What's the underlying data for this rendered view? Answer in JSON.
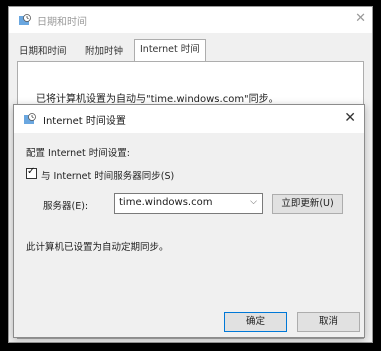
{
  "outer_window": {
    "title": "日期和时间",
    "tabs": [
      {
        "label": "日期和时间",
        "active": false
      },
      {
        "label": "附加时钟",
        "active": false
      },
      {
        "label": "Internet 时间",
        "active": true
      }
    ],
    "panel_text": "已将计算机设置为自动与\"time.windows.com\"同步。"
  },
  "dialog": {
    "title": "Internet 时间设置",
    "configure_label": "配置 Internet 时间设置:",
    "sync_checkbox": {
      "label": "与 Internet 时间服务器同步(S)",
      "checked": true
    },
    "server_label": "服务器(E):",
    "server_value": "time.windows.com",
    "update_button": "立即更新(U)",
    "status_text": "此计算机已设置为自动定期同步。",
    "ok_button": "确定",
    "cancel_button": "取消"
  },
  "colors": {
    "accent": "#0078d7",
    "window_bg": "#f0f0f0"
  }
}
